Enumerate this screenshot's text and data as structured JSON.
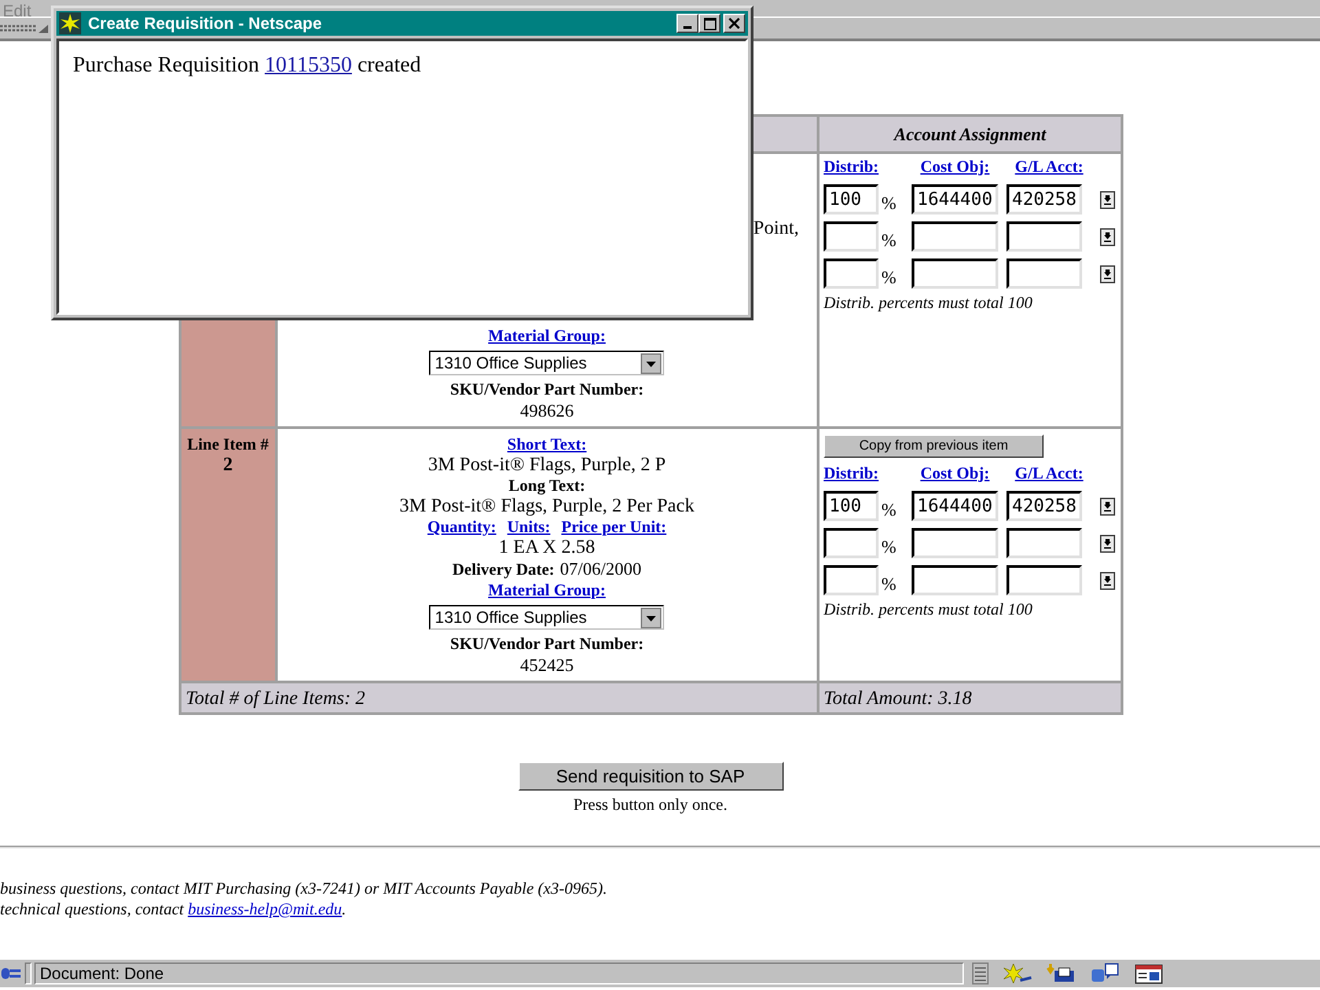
{
  "browser": {
    "menu": [
      "Edit"
    ],
    "status_bar": {
      "text": "Document: Done"
    }
  },
  "popup": {
    "title": "Create Requisition - Netscape",
    "message": {
      "before": "Purchase Requisition",
      "link": "10115350",
      "after": "created"
    }
  },
  "table": {
    "header": "Account Assignment",
    "line_items": [
      {
        "partial_text": "Point,",
        "material_group_label": "Material Group:",
        "material_group": "1310 Office Supplies",
        "sku_label": "SKU/Vendor Part Number:",
        "sku": "498626",
        "account": {
          "columns": [
            "Distrib:",
            "Cost Obj:",
            "G/L Acct:"
          ],
          "rows": [
            {
              "distrib": "100",
              "percent_sign": "%",
              "cost_obj": "1644400",
              "gl_acct": "420258"
            },
            {
              "percent_sign": "%"
            },
            {
              "percent_sign": "%"
            }
          ],
          "note": "Distrib. percents must total 100"
        }
      },
      {
        "label": "Line Item #",
        "number": "2",
        "short_text_label": "Short Text:",
        "short_text": "3M Post-it® Flags, Purple, 2 P",
        "long_text_label": "Long Text:",
        "long_text": "3M Post-it® Flags, Purple, 2 Per Pack",
        "quantity_labels": [
          "Quantity:",
          "Units:",
          "Price per Unit:"
        ],
        "quantity": "1 EA X 2.58",
        "delivery_label": "Delivery Date:",
        "delivery_date": "07/06/2000",
        "material_group_label": "Material Group:",
        "material_group": "1310 Office Supplies",
        "sku_label": "SKU/Vendor Part Number:",
        "sku": "452425",
        "account": {
          "copy_button": "Copy from previous item",
          "columns": [
            "Distrib:",
            "Cost Obj:",
            "G/L Acct:"
          ],
          "rows": [
            {
              "distrib": "100",
              "percent_sign": "%",
              "cost_obj": "1644400",
              "gl_acct": "420258"
            },
            {
              "percent_sign": "%"
            },
            {
              "percent_sign": "%"
            }
          ],
          "note": "Distrib. percents must total 100"
        }
      }
    ],
    "totals": {
      "items": "Total # of Line Items: 2",
      "amount": "Total Amount: 3.18"
    }
  },
  "send": {
    "button": "Send requisition to SAP",
    "note": "Press button only once."
  },
  "footer": [
    {
      "before": "business questions, contact MIT Purchasing (x3-7241) or MIT Accounts Payable (x3-0965)."
    },
    {
      "before": "technical questions, contact",
      "link": "business-help@mit.edu",
      "after": "."
    }
  ]
}
